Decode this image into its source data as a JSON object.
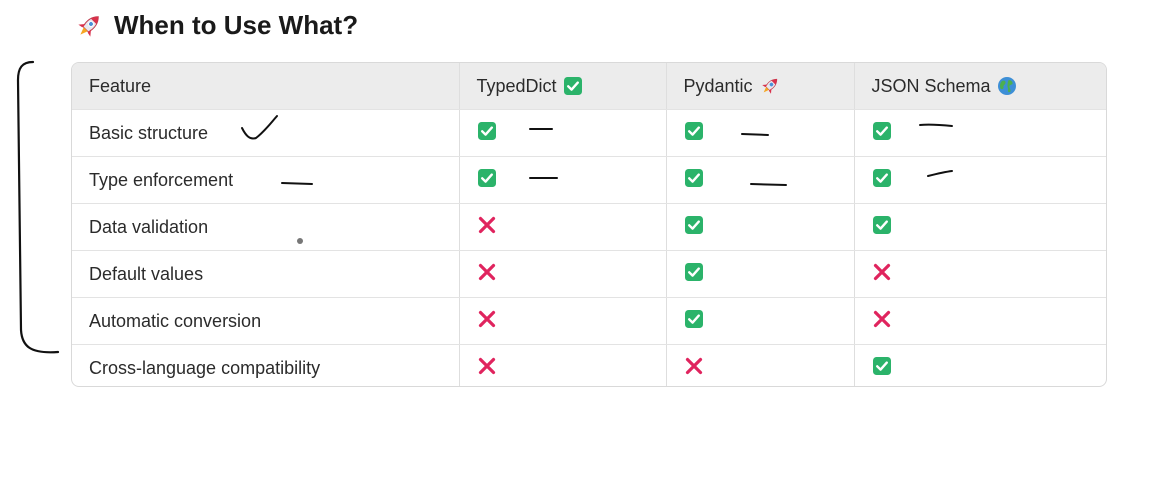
{
  "page": {
    "title": "When to Use What?",
    "title_icon": "rocket-icon"
  },
  "table": {
    "columns": [
      {
        "label": "Feature",
        "icon": ""
      },
      {
        "label": "TypedDict",
        "icon": "check-box-icon"
      },
      {
        "label": "Pydantic",
        "icon": "rocket-icon"
      },
      {
        "label": "JSON Schema",
        "icon": "globe-icon"
      }
    ],
    "rows": [
      {
        "feature": "Basic structure",
        "values": [
          "yes",
          "yes",
          "yes"
        ]
      },
      {
        "feature": "Type enforcement",
        "values": [
          "yes",
          "yes",
          "yes"
        ]
      },
      {
        "feature": "Data validation",
        "values": [
          "no",
          "yes",
          "yes"
        ]
      },
      {
        "feature": "Default values",
        "values": [
          "no",
          "yes",
          "no"
        ]
      },
      {
        "feature": "Automatic conversion",
        "values": [
          "no",
          "yes",
          "no"
        ]
      },
      {
        "feature": "Cross-language compatibility",
        "values": [
          "no",
          "no",
          "yes"
        ]
      }
    ]
  },
  "colors": {
    "check_green": "#2bb36a",
    "cross_red": "#e0245e",
    "header_bg": "#ececec",
    "ink": "#111111"
  }
}
